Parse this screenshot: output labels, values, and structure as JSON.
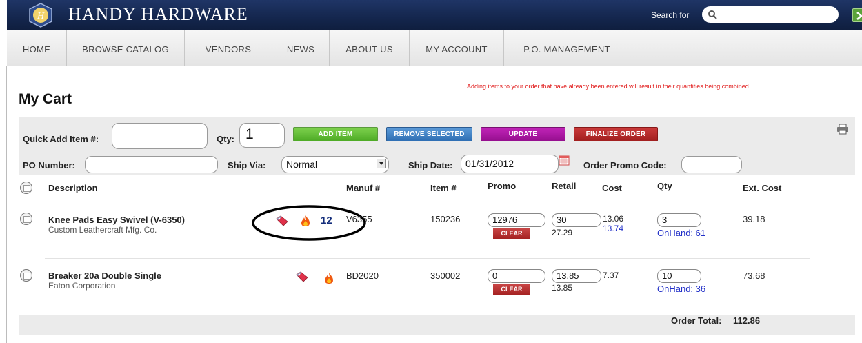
{
  "header": {
    "brand": "HANDY HARDWARE",
    "search_label": "Search for",
    "search_value": ""
  },
  "nav": {
    "items": [
      "HOME",
      "BROWSE CATALOG",
      "VENDORS",
      "NEWS",
      "ABOUT US",
      "MY ACCOUNT",
      "P.O. MANAGEMENT"
    ]
  },
  "page": {
    "title": "My Cart",
    "notice": "Adding items to your order that have already been entered will result in their quantities being combined."
  },
  "quick_add": {
    "item_label": "Quick Add Item #:",
    "item_value": "",
    "qty_label": "Qty:",
    "qty_value": "1",
    "buttons": {
      "add": "ADD ITEM",
      "remove": "REMOVE SELECTED",
      "update": "UPDATE",
      "finalize": "FINALIZE ORDER"
    },
    "po_label": "PO Number:",
    "po_value": "",
    "ship_via_label": "Ship Via:",
    "ship_via_value": "Normal",
    "ship_date_label": "Ship Date:",
    "ship_date_value": "01/31/2012",
    "promo_label": "Order Promo Code:",
    "promo_value": ""
  },
  "table": {
    "headers": {
      "description": "Description",
      "manuf": "Manuf #",
      "item": "Item #",
      "promo": "Promo",
      "retail": "Retail",
      "cost": "Cost",
      "qty": "Qty",
      "ext": "Ext. Cost"
    },
    "rows": [
      {
        "description": "Knee Pads Easy Swivel (V-6350)",
        "vendor": "Custom Leathercraft Mfg. Co.",
        "badge": "12",
        "manuf": "V6355",
        "item": "150236",
        "promo": "12976",
        "clear": "CLEAR",
        "retail": "30",
        "retail_sub": "27.29",
        "cost": "13.06",
        "cost_sub": "13.74",
        "qty": "3",
        "onhand": "OnHand: 61",
        "ext": "39.18"
      },
      {
        "description": "Breaker 20a Double Single",
        "vendor": "Eaton Corporation",
        "badge": "",
        "manuf": "BD2020",
        "item": "350002",
        "promo": "0",
        "clear": "CLEAR",
        "retail": "13.85",
        "retail_sub": "13.85",
        "cost": "7.37",
        "cost_sub": "",
        "qty": "10",
        "onhand": "OnHand: 36",
        "ext": "73.68"
      }
    ],
    "total_label": "Order Total:",
    "total_value": "112.86"
  },
  "colors": {
    "header": "#14264d",
    "add": "#4eab26",
    "remove": "#2f6fb4",
    "update": "#960f8f",
    "finalize": "#a21f1f",
    "notice": "#e11b1b",
    "onhand": "#2230c8"
  }
}
